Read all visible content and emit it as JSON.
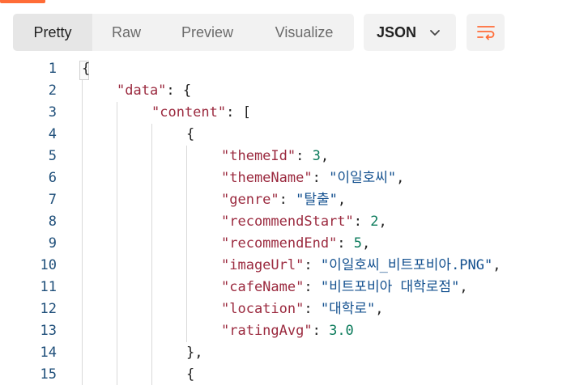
{
  "toolbar": {
    "tabs": [
      {
        "label": "Pretty",
        "active": true
      },
      {
        "label": "Raw",
        "active": false
      },
      {
        "label": "Preview",
        "active": false
      },
      {
        "label": "Visualize",
        "active": false
      }
    ],
    "format": "JSON",
    "wrap_icon": "wrap-lines-icon",
    "accent_color": "#ff6c37"
  },
  "editor": {
    "line_numbers": [
      "1",
      "2",
      "3",
      "4",
      "5",
      "6",
      "7",
      "8",
      "9",
      "10",
      "11",
      "12",
      "13",
      "14",
      "15"
    ],
    "lines": [
      {
        "indent": 0,
        "key": "",
        "value": "",
        "punct": "{"
      },
      {
        "indent": 1,
        "key": "\"data\"",
        "punct": ": {"
      },
      {
        "indent": 2,
        "key": "\"content\"",
        "punct": ": ["
      },
      {
        "indent": 3,
        "key": "",
        "punct": "{"
      },
      {
        "indent": 4,
        "key": "\"themeId\"",
        "sep": ": ",
        "value": "3",
        "vtype": "n",
        "tail": ","
      },
      {
        "indent": 4,
        "key": "\"themeName\"",
        "sep": ": ",
        "value": "\"이일호씨\"",
        "vtype": "s",
        "tail": ","
      },
      {
        "indent": 4,
        "key": "\"genre\"",
        "sep": ": ",
        "value": "\"탈출\"",
        "vtype": "s",
        "tail": ","
      },
      {
        "indent": 4,
        "key": "\"recommendStart\"",
        "sep": ": ",
        "value": "2",
        "vtype": "n",
        "tail": ","
      },
      {
        "indent": 4,
        "key": "\"recommendEnd\"",
        "sep": ": ",
        "value": "5",
        "vtype": "n",
        "tail": ","
      },
      {
        "indent": 4,
        "key": "\"imageUrl\"",
        "sep": ": ",
        "value": "\"이일호씨_비트포비아.PNG\"",
        "vtype": "s",
        "tail": ","
      },
      {
        "indent": 4,
        "key": "\"cafeName\"",
        "sep": ": ",
        "value": "\"비트포비아 대학로점\"",
        "vtype": "s",
        "tail": ","
      },
      {
        "indent": 4,
        "key": "\"location\"",
        "sep": ": ",
        "value": "\"대학로\"",
        "vtype": "s",
        "tail": ","
      },
      {
        "indent": 4,
        "key": "\"ratingAvg\"",
        "sep": ": ",
        "value": "3.0",
        "vtype": "n",
        "tail": ""
      },
      {
        "indent": 3,
        "key": "",
        "punct": "},"
      },
      {
        "indent": 3,
        "key": "",
        "punct": "{"
      }
    ]
  }
}
